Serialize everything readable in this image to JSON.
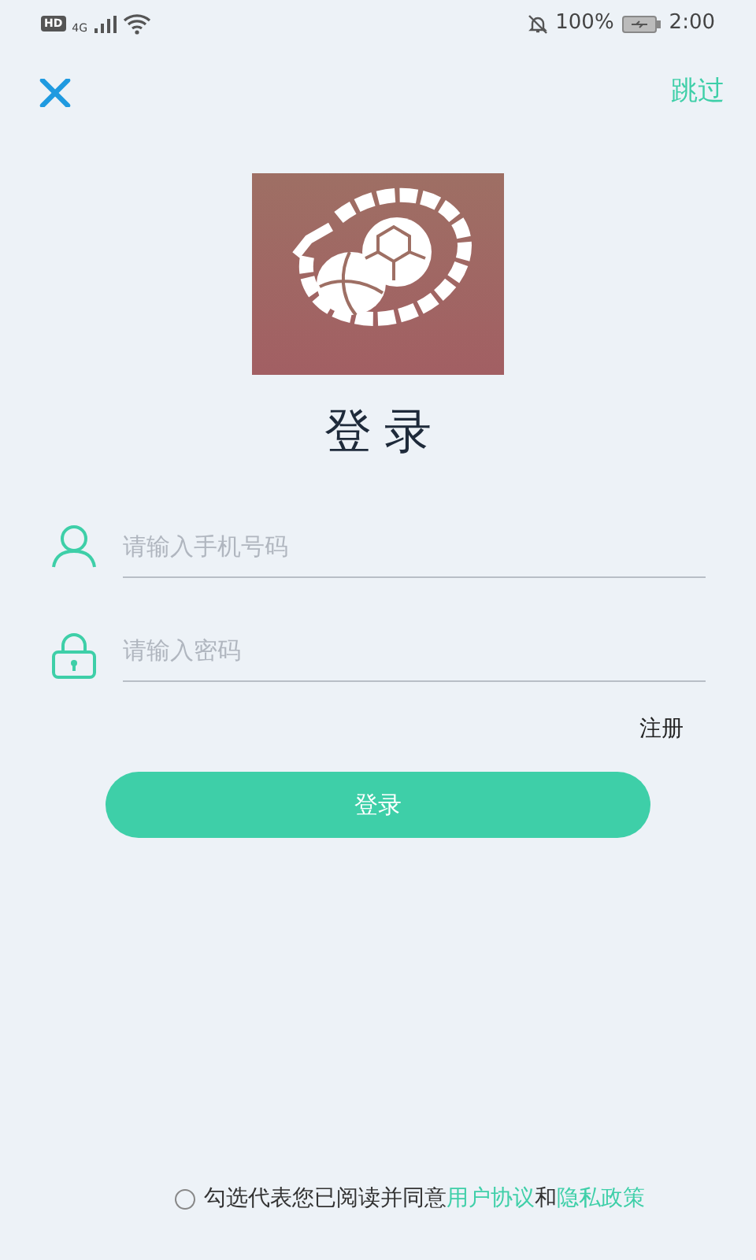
{
  "status_bar": {
    "hd": "HD",
    "network": "4G",
    "battery": "100%",
    "time": "2:00"
  },
  "top_bar": {
    "skip": "跳过"
  },
  "title": "登录",
  "fields": [
    {
      "kind": "phone",
      "placeholder": "请输入手机号码"
    },
    {
      "kind": "password",
      "placeholder": "请输入密码"
    }
  ],
  "register_link": "注册",
  "login_button": "登录",
  "agreement": {
    "checked": false,
    "text": "勾选代表您已阅读并同意",
    "user_agreement": "用户协议",
    "conjunction": "和",
    "privacy_policy": "隐私政策"
  }
}
